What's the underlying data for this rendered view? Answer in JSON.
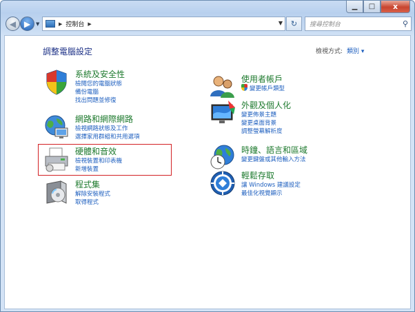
{
  "window": {
    "caption_buttons": {
      "minimize": "▁",
      "maximize": "□",
      "close": "x"
    }
  },
  "navbar": {
    "address_segments": [
      "控制台"
    ],
    "search_placeholder": "搜尋控制台"
  },
  "main": {
    "title": "調整電腦設定",
    "view_by_label": "檢視方式:",
    "view_by_value": "類別 ▾",
    "left_categories": [
      {
        "title": "系統及安全性",
        "links": [
          "檢閱您的電腦狀態",
          "備份電腦",
          "找出問題並修復"
        ],
        "icon": "system-security-icon"
      },
      {
        "title": "網路和網際網路",
        "links": [
          "檢視網路狀態及工作",
          "選擇家用群組和共用選項"
        ],
        "icon": "network-icon"
      },
      {
        "title": "硬體和音效",
        "links": [
          "檢視裝置和印表機",
          "新增裝置"
        ],
        "icon": "printer-icon"
      },
      {
        "title": "程式集",
        "links": [
          "解除安裝程式",
          "取得程式"
        ],
        "icon": "programs-icon"
      }
    ],
    "right_categories": [
      {
        "title": "使用者帳戶",
        "links": [
          "變更帳戶類型"
        ],
        "icon": "user-accounts-icon"
      },
      {
        "title": "外觀及個人化",
        "links": [
          "變更佈景主題",
          "變更桌面背景",
          "調整螢幕解析度"
        ],
        "icon": "appearance-icon"
      },
      {
        "title": "時鐘、語言和區域",
        "links": [
          "變更鍵盤或其他輸入方法"
        ],
        "icon": "clock-globe-icon"
      },
      {
        "title": "輕鬆存取",
        "links": [
          "讓 Windows 建議設定",
          "最佳化視覺顯示"
        ],
        "icon": "ease-of-access-icon"
      }
    ]
  }
}
